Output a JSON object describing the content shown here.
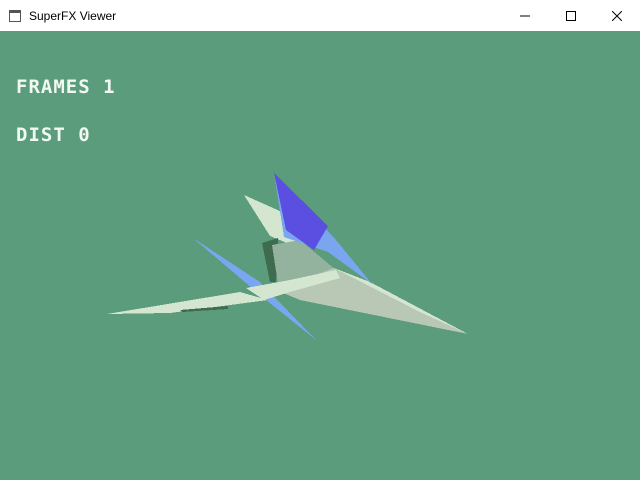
{
  "window": {
    "title": "SuperFX Viewer",
    "controls": [
      "minimize",
      "maximize",
      "close"
    ]
  },
  "hud": {
    "frames_label": "FRAMES",
    "frames_value": "1",
    "dist_label": "DIST",
    "dist_value": "0"
  },
  "colors": {
    "background": "#5a9c7b",
    "hud_text": "#f0f8f0",
    "wing_light": "#d4e6d0",
    "fin_blue": "#7aa6f0",
    "fin_purple": "#5a4fe0",
    "body_gray": "#b8c8b4",
    "shadow_green": "#3f6b4e"
  },
  "icons": {
    "app": "window-app-icon",
    "minimize": "minimize-icon",
    "maximize": "maximize-icon",
    "close": "close-icon"
  }
}
